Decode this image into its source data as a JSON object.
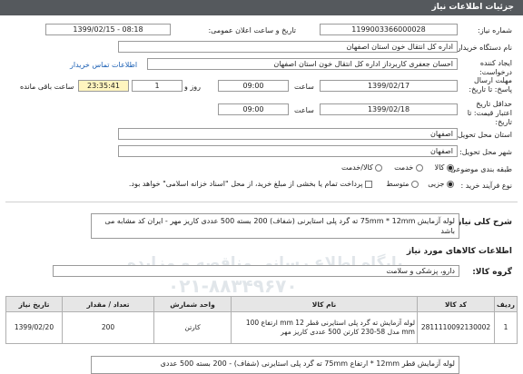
{
  "header": {
    "title": "جزئیات اطلاعات نیاز"
  },
  "form": {
    "need_number_label": "شماره نیاز:",
    "need_number": "1199003366000028",
    "announce_label": "تاریخ و ساعت اعلان عمومی:",
    "announce_value": "1399/02/15 - 08:18",
    "buyer_label": "نام دستگاه خریدار:",
    "buyer_value": "اداره کل انتقال خون استان اصفهان",
    "creator_label": "ایجاد کننده درخواست:",
    "creator_value": "احسان جعفری کاربرداز اداره کل انتقال خون استان اصفهان",
    "contact_link": "اطلاعات تماس خریدار",
    "deadline_label": "مهلت ارسال پاسخ: تا تاریخ:",
    "deadline_date": "1399/02/17",
    "time_label": "ساعت",
    "deadline_time": "09:00",
    "day_label": "روز و",
    "days_value": "1",
    "remain_value": "23:35:41",
    "remain_label": "ساعت باقی مانده",
    "validity_label": "حداقل تاریخ اعتبار قیمت: تا تاریخ:",
    "validity_date": "1399/02/18",
    "validity_time": "09:00",
    "province_label": "استان محل تحویل:",
    "province_value": "اصفهان",
    "city_label": "شهر محل تحویل:",
    "city_value": "اصفهان",
    "category_label": "طبقه بندی موضوعی:",
    "opt_goods": "کالا",
    "opt_service": "خدمت",
    "opt_goods_service": "کالا/خدمت",
    "process_label": "نوع فرآیند خرید :",
    "opt_partial": "جزیی",
    "opt_medium": "متوسط",
    "payment_note": "پرداخت تمام یا بخشی از مبلغ خرید، از محل \"اسناد خزانه اسلامی\" خواهد بود."
  },
  "summary": {
    "label": "شرح کلی نیاز:",
    "text": "لوله آزمایش 75mm * 12mm ته گرد پلی استایرنی (شفاف) 200 بسته 500 عددی کاریز مهر - ایران کد مشابه می باشد"
  },
  "goods_section": {
    "title": "اطلاعات کالاهای مورد نیاز"
  },
  "goods_group": {
    "label": "گروه کالا:",
    "value": "دارو، پزشکی و سلامت"
  },
  "table": {
    "headers": [
      "ردیف",
      "کد کالا",
      "نام کالا",
      "واحد شمارش",
      "تعداد / مقدار",
      "تاریخ نیاز"
    ],
    "rows": [
      {
        "index": "1",
        "code": "2811110092130002",
        "name": "لوله آزمایش ته گرد پلی استایرنی قطر 12 mm ارتفاع 100 mm مدل 58-230 کارتن 500 عددی کاریز مهر",
        "unit": "کارتن",
        "qty": "200",
        "date": "1399/02/20"
      }
    ]
  },
  "bottom_note": "لوله آزمایش قطر 12mm * ارتفاع 75mm ته گرد پلی استایرنی (شفاف) - 200 بسته 500 عددی",
  "watermark": {
    "line1": "پایگاه اطلاع رسانی مناقصه و مزایده",
    "line2": "۰۲۱-۸۸۳۴۹۶۷۰"
  }
}
